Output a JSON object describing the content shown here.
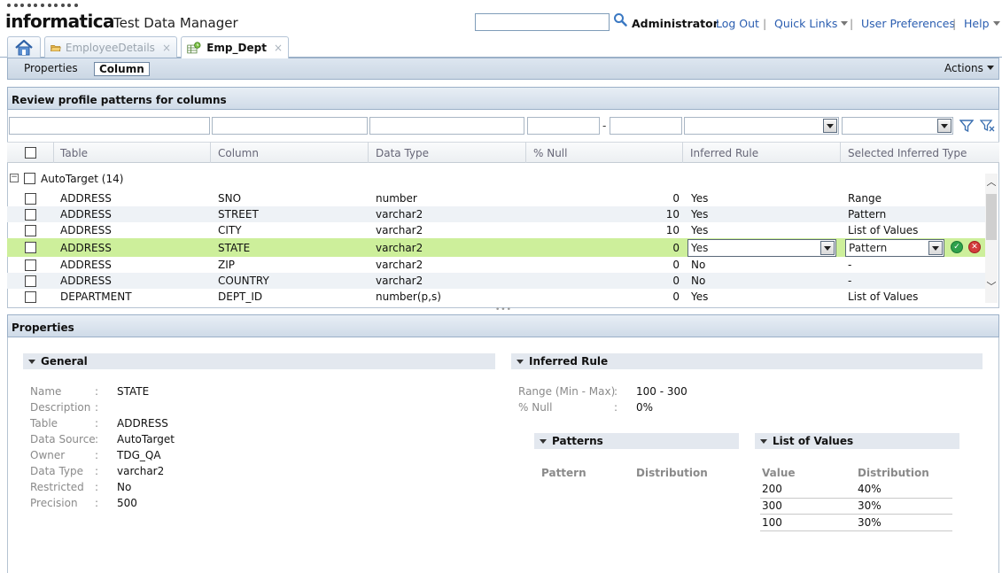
{
  "header": {
    "logo": "informatica",
    "product": "Test Data Manager",
    "search_value": "",
    "user": "Administrator",
    "logout": "Log Out",
    "quick_links": "Quick Links",
    "user_preferences": "User Preferences",
    "help": "Help"
  },
  "tabs": [
    {
      "label": "EmployeeDetails",
      "close": "×"
    },
    {
      "label": "Emp_Dept",
      "close": "×"
    }
  ],
  "subnav": {
    "properties": "Properties",
    "column": "Column",
    "actions": "Actions"
  },
  "grid": {
    "title": "Review profile patterns for columns",
    "range_dash": "-",
    "columns": [
      "Table",
      "Column",
      "Data Type",
      "% Null",
      "Inferred Rule",
      "Selected Inferred Type"
    ],
    "group": "AutoTarget  (14)",
    "rows": [
      {
        "table": "ADDRESS",
        "column": "SNO",
        "type": "number",
        "null": "0",
        "rule": "Yes",
        "inferred": "Range"
      },
      {
        "table": "ADDRESS",
        "column": "STREET",
        "type": "varchar2",
        "null": "10",
        "rule": "Yes",
        "inferred": "Pattern"
      },
      {
        "table": "ADDRESS",
        "column": "CITY",
        "type": "varchar2",
        "null": "10",
        "rule": "Yes",
        "inferred": "List of Values"
      },
      {
        "table": "ADDRESS",
        "column": "STATE",
        "type": "varchar2",
        "null": "0",
        "rule": "Yes",
        "inferred": "Pattern"
      },
      {
        "table": "ADDRESS",
        "column": "ZIP",
        "type": "varchar2",
        "null": "0",
        "rule": "No",
        "inferred": "-"
      },
      {
        "table": "ADDRESS",
        "column": "COUNTRY",
        "type": "varchar2",
        "null": "0",
        "rule": "No",
        "inferred": "-"
      },
      {
        "table": "DEPARTMENT",
        "column": "DEPT_ID",
        "type": "number(p,s)",
        "null": "0",
        "rule": "Yes",
        "inferred": "List of Values"
      }
    ]
  },
  "properties": {
    "title": "Properties",
    "general": {
      "heading": "General",
      "fields": [
        {
          "label": "Name",
          "value": "STATE"
        },
        {
          "label": "Description",
          "value": ""
        },
        {
          "label": "Table",
          "value": "ADDRESS"
        },
        {
          "label": "Data Source",
          "value": "AutoTarget"
        },
        {
          "label": "Owner",
          "value": "TDG_QA"
        },
        {
          "label": "Data Type",
          "value": "varchar2"
        },
        {
          "label": "Restricted",
          "value": "No"
        },
        {
          "label": "Precision",
          "value": "500"
        }
      ]
    },
    "inferred_rule": {
      "heading": "Inferred Rule",
      "fields": [
        {
          "label": "Range (Min - Max)",
          "value": "100 - 300"
        },
        {
          "label": "% Null",
          "value": "0%"
        }
      ]
    },
    "patterns": {
      "heading": "Patterns",
      "col_pattern": "Pattern",
      "col_distribution": "Distribution"
    },
    "list_of_values": {
      "heading": "List of Values",
      "col_value": "Value",
      "col_distribution": "Distribution",
      "rows": [
        {
          "value": "200",
          "distribution": "40%"
        },
        {
          "value": "300",
          "distribution": "30%"
        },
        {
          "value": "100",
          "distribution": "30%"
        }
      ]
    }
  },
  "colors": {
    "selected_row": "#cdef9b",
    "panel_header": "#cfdbe8",
    "link": "#2a5db0"
  }
}
